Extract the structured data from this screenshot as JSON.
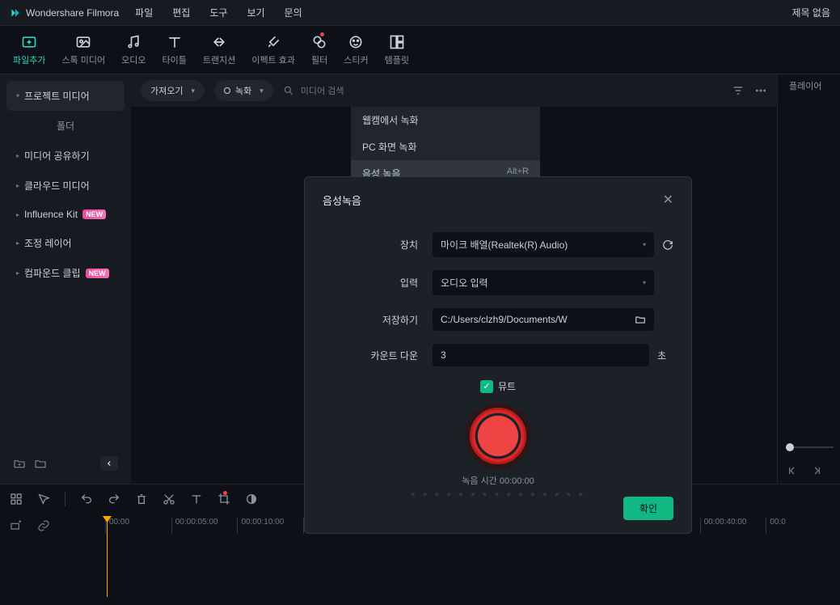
{
  "app": {
    "name": "Wondershare Filmora",
    "title": "제목 없음"
  },
  "menu": [
    "파일",
    "편집",
    "도구",
    "보기",
    "문의"
  ],
  "tools": [
    {
      "label": "파일추가",
      "active": true
    },
    {
      "label": "스톡 미디어"
    },
    {
      "label": "오디오"
    },
    {
      "label": "타이틀"
    },
    {
      "label": "트랜지션"
    },
    {
      "label": "이펙트 효과"
    },
    {
      "label": "필터",
      "dot": true
    },
    {
      "label": "스티커"
    },
    {
      "label": "템플릿"
    }
  ],
  "sidebar": {
    "project": "프로젝트 미디어",
    "folder": "폴더",
    "items": [
      {
        "label": "미디어 공유하기"
      },
      {
        "label": "클라우드 미디어"
      },
      {
        "label": "Influence Kit",
        "badge": "NEW"
      },
      {
        "label": "조정 레이어"
      },
      {
        "label": "컴파운드 클립",
        "badge": "NEW"
      }
    ]
  },
  "contentBar": {
    "import": "가져오기",
    "record": "녹화",
    "searchPh": "미디어 검색"
  },
  "recMenu": [
    {
      "label": "웹캠에서 녹화"
    },
    {
      "label": "PC 화면 녹화"
    },
    {
      "label": "음성 녹음",
      "shortcut": "Alt+R",
      "selected": true
    }
  ],
  "player": {
    "tab": "플레이어"
  },
  "modal": {
    "title": "음성녹음",
    "device": {
      "label": "장치",
      "value": "마이크 배열(Realtek(R) Audio)"
    },
    "input": {
      "label": "입력",
      "value": "오디오 입력"
    },
    "save": {
      "label": "저장하기",
      "value": "C:/Users/clzh9/Documents/W"
    },
    "countdown": {
      "label": "카운트 다운",
      "value": "3",
      "unit": "초"
    },
    "mute": "뮤트",
    "time": {
      "label": "녹음 시간",
      "value": "00:00:00"
    },
    "ok": "확인"
  },
  "ruler": [
    "00:00",
    "00:00:05:00",
    "00:00:10:00",
    "",
    "",
    "",
    "",
    "",
    "",
    "00:00:40:00",
    "00:0"
  ]
}
